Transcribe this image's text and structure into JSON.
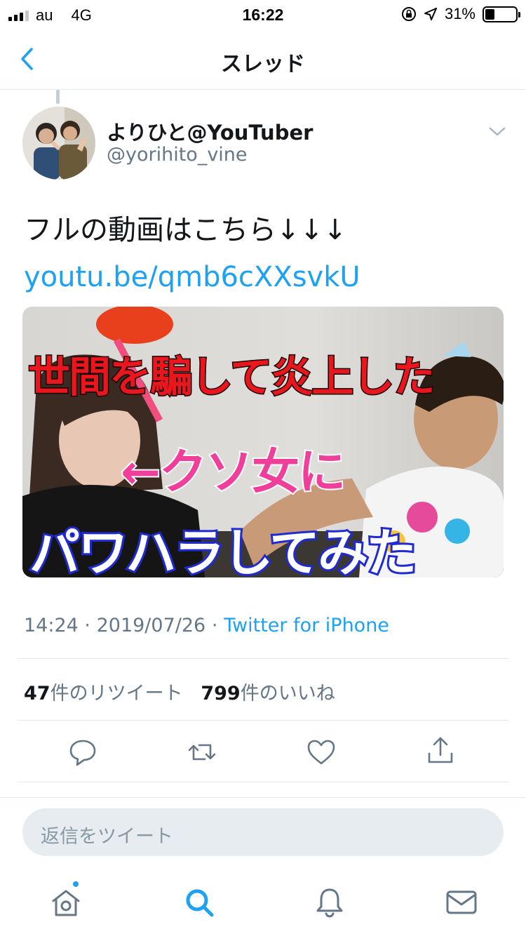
{
  "status_bar": {
    "carrier": "au",
    "network": "4G",
    "time": "16:22",
    "battery": "31%",
    "battery_level": 0.31
  },
  "nav": {
    "title": "スレッド",
    "back_icon": "chevron-left-icon"
  },
  "tweet": {
    "author_name": "よりひと@YouTuber",
    "author_handle": "@yorihito_vine",
    "text": "フルの動画はこちら↓↓↓",
    "link": "youtu.be/qmb6cXXsvkU",
    "media": {
      "line1": "世間を騙して炎上した",
      "line2": "←クソ女に",
      "line3": "パワハラしてみた"
    },
    "time": "14:24",
    "separator": "·",
    "date": "2019/07/26",
    "source": "Twitter for iPhone",
    "retweet_count": "47",
    "retweet_label": "件のリツイート",
    "like_count": "799",
    "like_label": "件のいいね"
  },
  "actions": [
    "reply-icon",
    "retweet-icon",
    "like-icon",
    "share-icon"
  ],
  "reply_bar": {
    "placeholder": "返信をツイート"
  },
  "tab_bar": [
    "home-icon",
    "search-icon",
    "notifications-icon",
    "messages-icon"
  ],
  "colors": {
    "accent": "#1da1f2",
    "secondary_text": "#657786",
    "divider": "#e1e8ed"
  }
}
